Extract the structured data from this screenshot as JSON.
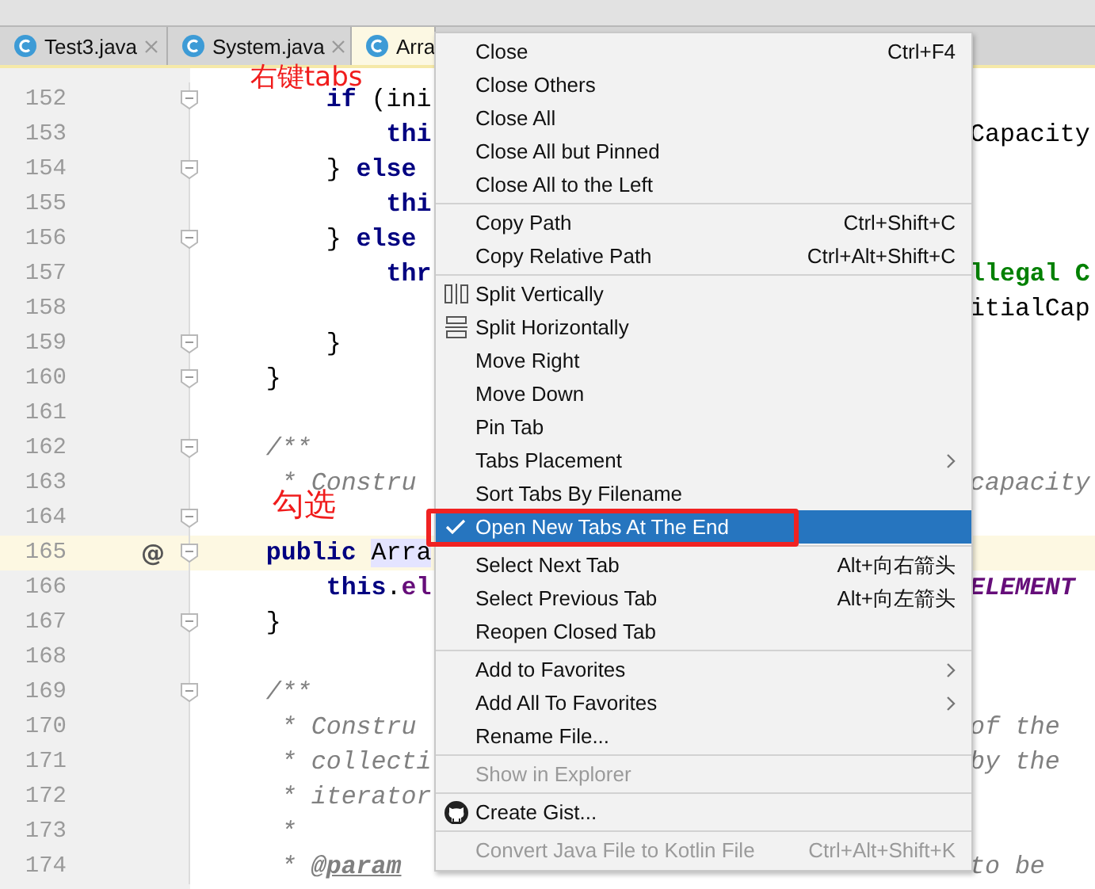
{
  "tabs": [
    {
      "label": "Test3.java",
      "selected": false,
      "closable": true
    },
    {
      "label": "System.java",
      "selected": false,
      "closable": true
    },
    {
      "label": "Arra",
      "selected": true,
      "closable": false
    }
  ],
  "editor": {
    "lines": [
      {
        "number": "152",
        "fold": true,
        "current": false,
        "left": [
          {
            "t": "        if",
            "kind": "keyword"
          },
          {
            "t": " (ini",
            "kind": "plain"
          }
        ]
      },
      {
        "number": "153",
        "fold": false,
        "current": false,
        "left": [
          {
            "t": "            thi",
            "kind": "keyword"
          }
        ],
        "right": [
          {
            "t": "Capacity",
            "kind": "plain"
          }
        ]
      },
      {
        "number": "154",
        "fold": true,
        "current": false,
        "left": [
          {
            "t": "        } ",
            "kind": "plain"
          },
          {
            "t": "else",
            "kind": "keyword"
          }
        ]
      },
      {
        "number": "155",
        "fold": false,
        "current": false,
        "left": [
          {
            "t": "            thi",
            "kind": "keyword"
          }
        ]
      },
      {
        "number": "156",
        "fold": true,
        "current": false,
        "left": [
          {
            "t": "        } ",
            "kind": "plain"
          },
          {
            "t": "else",
            "kind": "keyword"
          }
        ]
      },
      {
        "number": "157",
        "fold": false,
        "current": false,
        "left": [
          {
            "t": "            thr",
            "kind": "keyword"
          }
        ],
        "right": [
          {
            "t": "llegal C",
            "kind": "string"
          }
        ]
      },
      {
        "number": "158",
        "fold": false,
        "current": false,
        "right": [
          {
            "t": "itialCap",
            "kind": "plain"
          }
        ]
      },
      {
        "number": "159",
        "fold": true,
        "current": false,
        "left": [
          {
            "t": "        }",
            "kind": "plain"
          }
        ]
      },
      {
        "number": "160",
        "fold": true,
        "current": false,
        "left": [
          {
            "t": "    }",
            "kind": "plain"
          }
        ]
      },
      {
        "number": "161",
        "fold": false,
        "current": false
      },
      {
        "number": "162",
        "fold": true,
        "current": false,
        "left": [
          {
            "t": "    /**",
            "kind": "comment"
          }
        ]
      },
      {
        "number": "163",
        "fold": false,
        "current": false,
        "left": [
          {
            "t": "     * Constru",
            "kind": "comment"
          }
        ],
        "right": [
          {
            "t": "capacity",
            "kind": "comment"
          }
        ]
      },
      {
        "number": "164",
        "fold": true,
        "current": false
      },
      {
        "number": "165",
        "fold": true,
        "current": true,
        "mark": "@",
        "left": [
          {
            "t": "    public ",
            "kind": "keyword"
          },
          {
            "t": "Arra",
            "kind": "usage"
          }
        ]
      },
      {
        "number": "166",
        "fold": false,
        "current": false,
        "left": [
          {
            "t": "        this",
            "kind": "keyword"
          },
          {
            "t": ".",
            "kind": "plain"
          },
          {
            "t": "el",
            "kind": "field"
          }
        ],
        "right": [
          {
            "t": "ELEMENT",
            "kind": "static"
          }
        ]
      },
      {
        "number": "167",
        "fold": true,
        "current": false,
        "left": [
          {
            "t": "    }",
            "kind": "plain"
          }
        ]
      },
      {
        "number": "168",
        "fold": false,
        "current": false
      },
      {
        "number": "169",
        "fold": true,
        "current": false,
        "left": [
          {
            "t": "    /**",
            "kind": "comment"
          }
        ]
      },
      {
        "number": "170",
        "fold": false,
        "current": false,
        "left": [
          {
            "t": "     * Constru",
            "kind": "comment"
          }
        ],
        "right": [
          {
            "t": "of the",
            "kind": "comment"
          }
        ]
      },
      {
        "number": "171",
        "fold": false,
        "current": false,
        "left": [
          {
            "t": "     * collecti",
            "kind": "comment"
          }
        ],
        "right": [
          {
            "t": "by the",
            "kind": "comment"
          }
        ]
      },
      {
        "number": "172",
        "fold": false,
        "current": false,
        "left": [
          {
            "t": "     * iterator",
            "kind": "comment"
          }
        ]
      },
      {
        "number": "173",
        "fold": false,
        "current": false,
        "left": [
          {
            "t": "     *",
            "kind": "comment"
          }
        ]
      },
      {
        "number": "174",
        "fold": false,
        "current": false,
        "left": [
          {
            "t": "     * ",
            "kind": "comment"
          },
          {
            "t": "@param",
            "kind": "tag"
          }
        ],
        "right": [
          {
            "t": "to be",
            "kind": "comment"
          }
        ]
      }
    ]
  },
  "context_menu": {
    "items": [
      {
        "kind": "item",
        "label": "Close",
        "shortcut": "Ctrl+F4",
        "checked": false,
        "selected": false,
        "disabled": false,
        "submenu": false
      },
      {
        "kind": "item",
        "label": "Close Others",
        "checked": false,
        "selected": false,
        "disabled": false,
        "submenu": false
      },
      {
        "kind": "item",
        "label": "Close All",
        "checked": false,
        "selected": false,
        "disabled": false,
        "submenu": false
      },
      {
        "kind": "item",
        "label": "Close All but Pinned",
        "checked": false,
        "selected": false,
        "disabled": false,
        "submenu": false
      },
      {
        "kind": "item",
        "label": "Close All to the Left",
        "checked": false,
        "selected": false,
        "disabled": false,
        "submenu": false
      },
      {
        "kind": "separator"
      },
      {
        "kind": "item",
        "label": "Copy Path",
        "shortcut": "Ctrl+Shift+C",
        "checked": false,
        "selected": false,
        "disabled": false,
        "submenu": false
      },
      {
        "kind": "item",
        "label": "Copy Relative Path",
        "shortcut": "Ctrl+Alt+Shift+C",
        "checked": false,
        "selected": false,
        "disabled": false,
        "submenu": false
      },
      {
        "kind": "separator"
      },
      {
        "kind": "vsplit",
        "label": "Split Vertically",
        "checked": false,
        "selected": false,
        "disabled": false,
        "submenu": false
      },
      {
        "kind": "hsplit",
        "label": "Split Horizontally",
        "checked": false,
        "selected": false,
        "disabled": false,
        "submenu": false
      },
      {
        "kind": "item",
        "label": "Move Right",
        "checked": false,
        "selected": false,
        "disabled": false,
        "submenu": false
      },
      {
        "kind": "item",
        "label": "Move Down",
        "checked": false,
        "selected": false,
        "disabled": false,
        "submenu": false
      },
      {
        "kind": "item",
        "label": "Pin Tab",
        "checked": false,
        "selected": false,
        "disabled": false,
        "submenu": false
      },
      {
        "kind": "item",
        "label": "Tabs Placement",
        "checked": false,
        "selected": false,
        "disabled": false,
        "submenu": true
      },
      {
        "kind": "item",
        "label": "Sort Tabs By Filename",
        "checked": false,
        "selected": false,
        "disabled": false,
        "submenu": false
      },
      {
        "kind": "item",
        "label": "Open New Tabs At The End",
        "checked": true,
        "selected": true,
        "disabled": false,
        "submenu": false
      },
      {
        "kind": "separator"
      },
      {
        "kind": "item",
        "label": "Select Next Tab",
        "shortcut": "Alt+向右箭头",
        "checked": false,
        "selected": false,
        "disabled": false,
        "submenu": false
      },
      {
        "kind": "item",
        "label": "Select Previous Tab",
        "shortcut": "Alt+向左箭头",
        "checked": false,
        "selected": false,
        "disabled": false,
        "submenu": false
      },
      {
        "kind": "item",
        "label": "Reopen Closed Tab",
        "checked": false,
        "selected": false,
        "disabled": false,
        "submenu": false
      },
      {
        "kind": "separator"
      },
      {
        "kind": "item",
        "label": "Add to Favorites",
        "checked": false,
        "selected": false,
        "disabled": false,
        "submenu": true
      },
      {
        "kind": "item",
        "label": "Add All To Favorites",
        "checked": false,
        "selected": false,
        "disabled": false,
        "submenu": true
      },
      {
        "kind": "item",
        "label": "Rename File...",
        "checked": false,
        "selected": false,
        "disabled": false,
        "submenu": false
      },
      {
        "kind": "separator"
      },
      {
        "kind": "item",
        "label": "Show in Explorer",
        "checked": false,
        "selected": false,
        "disabled": true,
        "submenu": false
      },
      {
        "kind": "separator"
      },
      {
        "kind": "gist",
        "label": "Create Gist...",
        "checked": false,
        "selected": false,
        "disabled": false,
        "submenu": false
      },
      {
        "kind": "separator"
      },
      {
        "kind": "item",
        "label": "Convert Java File to Kotlin File",
        "shortcut": "Ctrl+Alt+Shift+K",
        "checked": false,
        "selected": false,
        "disabled": true,
        "submenu": false
      }
    ]
  },
  "annotations": [
    {
      "kind": "note",
      "text": "右键tabs"
    },
    {
      "kind": "note",
      "text": "勾选"
    },
    {
      "kind": "highlight-box"
    }
  ]
}
